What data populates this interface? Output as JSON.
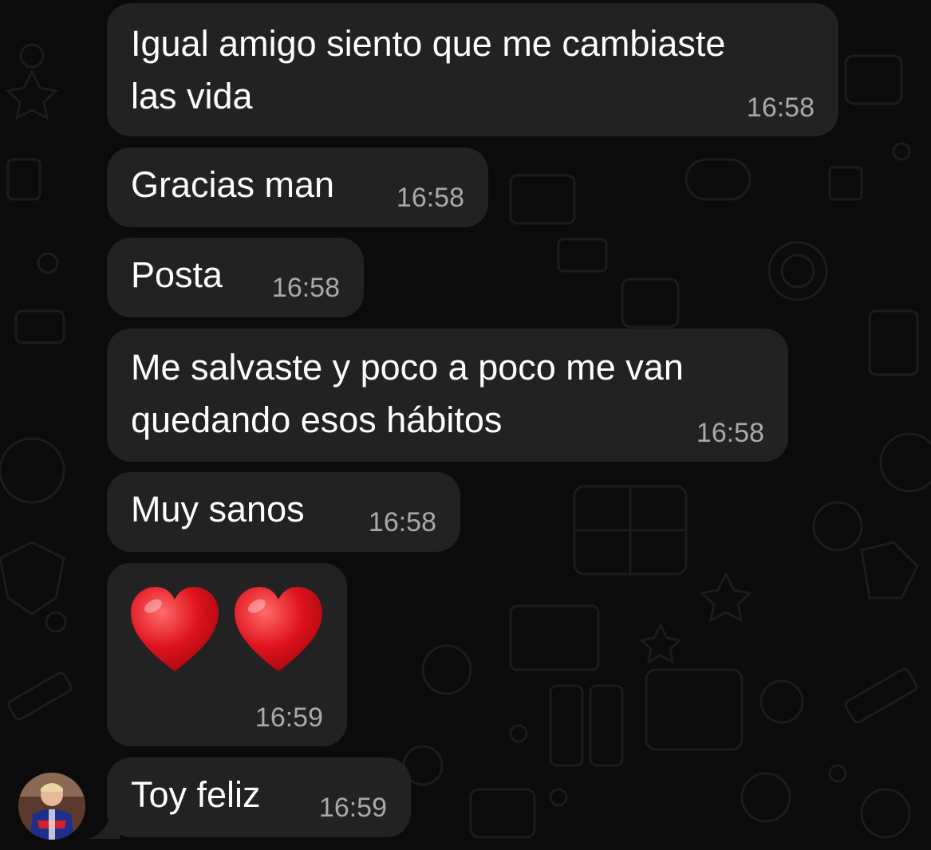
{
  "messages": [
    {
      "text_line1": "Igual amigo siento que me cambiaste",
      "text_line2": "las vida",
      "time": "16:58"
    },
    {
      "text": "Gracias man",
      "time": "16:58"
    },
    {
      "text": "Posta",
      "time": "16:58"
    },
    {
      "text_line1": "Me salvaste y poco a poco me van",
      "text_line2": "quedando esos hábitos",
      "time": "16:58"
    },
    {
      "text": "Muy sanos",
      "time": "16:58"
    },
    {
      "emoji": "heart-heart",
      "time": "16:59"
    },
    {
      "text": "Toy feliz",
      "time": "16:59"
    }
  ],
  "colors": {
    "background": "#0b0b0b",
    "bubble": "#222222",
    "text": "#ffffff",
    "timestamp": "#a9a9a9",
    "heart": "#e0141e"
  },
  "icons": [
    "heart-icon",
    "avatar-photo"
  ]
}
